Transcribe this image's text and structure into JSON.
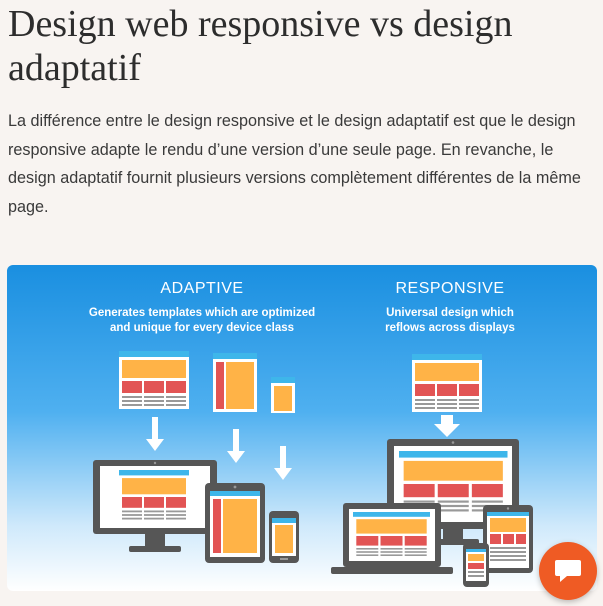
{
  "article": {
    "title": "Design web responsive vs design adaptatif",
    "intro": "La différence entre le design responsive et le design adaptatif est que le design responsive adapte le rendu d’une version d’une seule page. En revanche, le design adaptatif fournit plusieurs versions complètement différentes de la même page."
  },
  "figure": {
    "adaptive": {
      "heading": "ADAPTIVE",
      "line1": "Generates templates which are optimized",
      "line2": "and unique for every device class"
    },
    "responsive": {
      "heading": "RESPONSIVE",
      "line1": "Universal design which",
      "line2": "reflows across displays"
    },
    "colors": {
      "sky_top": "#1a8fe0",
      "sky_bottom": "#ffffff",
      "header": "#3eb6ea",
      "orange": "#ffb347",
      "red": "#e25454",
      "device": "#565656",
      "paper": "#ffffff"
    }
  },
  "chat": {
    "icon": "chat-bubble-icon",
    "color": "#ef5b24"
  }
}
